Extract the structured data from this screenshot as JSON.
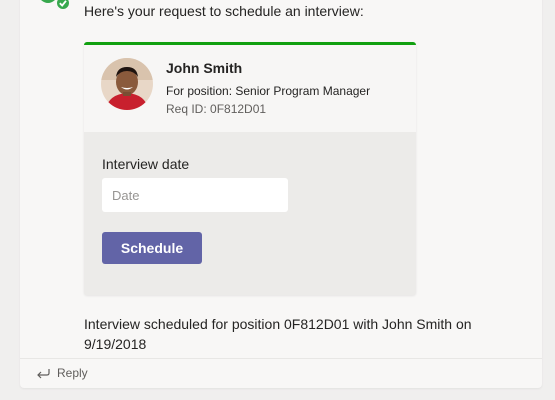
{
  "message": {
    "intro": "Here's your request to schedule an interview:",
    "confirmation": "Interview scheduled for position 0F812D01 with John Smith on 9/19/2018"
  },
  "card": {
    "accent_color": "#11a00f",
    "person": {
      "name": "John Smith",
      "position": "For position: Senior Program Manager",
      "req_id": "Req ID: 0F812D01"
    },
    "form": {
      "date_label": "Interview date",
      "date_placeholder": "Date",
      "date_value": "",
      "schedule_label": "Schedule",
      "button_color": "#6264a7"
    }
  },
  "footer": {
    "reply_label": "Reply",
    "reply_icon": "reply-arrow-icon"
  },
  "icons": {
    "bot_avatar": "bot-avatar-icon",
    "verified_badge": "check-badge-icon"
  }
}
